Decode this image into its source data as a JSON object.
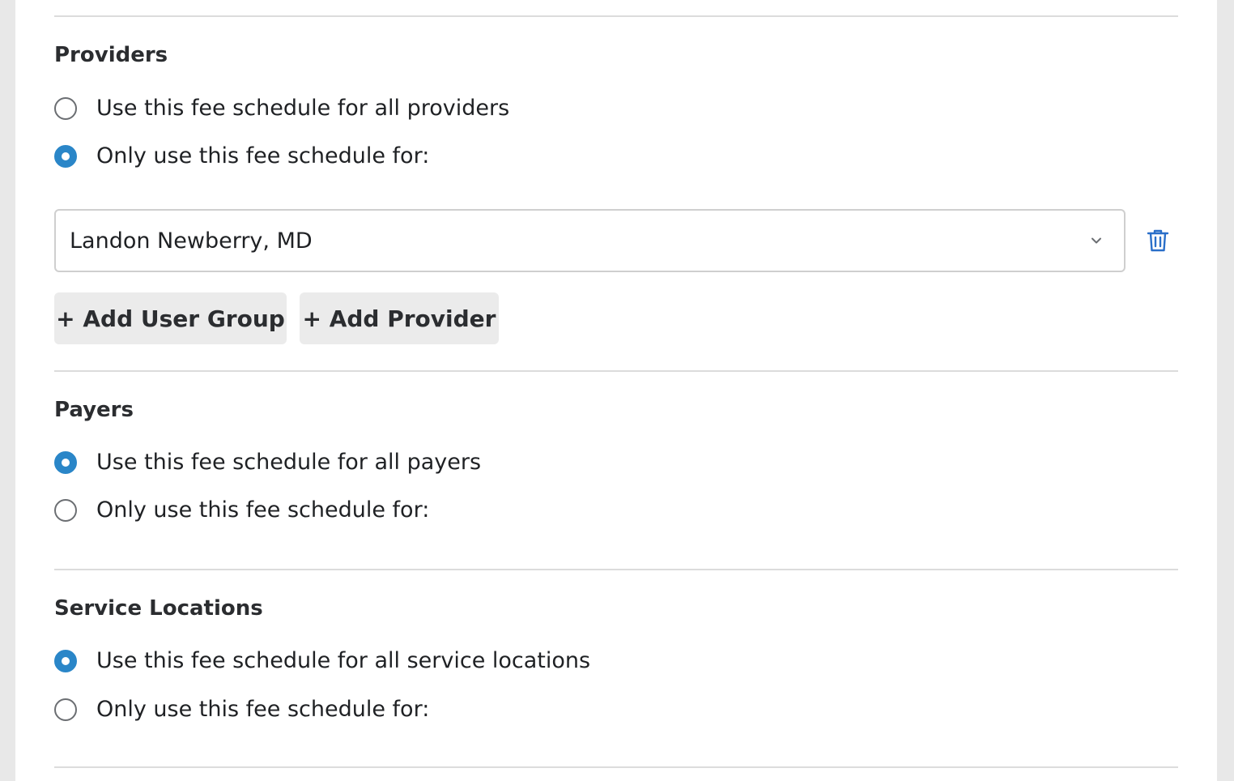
{
  "providers": {
    "title": "Providers",
    "options": [
      {
        "label": "Use this fee schedule for all providers",
        "selected": false
      },
      {
        "label": "Only use this fee schedule for:",
        "selected": true
      }
    ],
    "selected_provider": "Landon Newberry, MD",
    "add_user_group_label": "+ Add User Group",
    "add_provider_label": "+ Add Provider"
  },
  "payers": {
    "title": "Payers",
    "options": [
      {
        "label": "Use this fee schedule for all payers",
        "selected": true
      },
      {
        "label": "Only use this fee schedule for:",
        "selected": false
      }
    ]
  },
  "service_locations": {
    "title": "Service Locations",
    "options": [
      {
        "label": "Use this fee schedule for all service locations",
        "selected": true
      },
      {
        "label": "Only use this fee schedule for:",
        "selected": false
      }
    ]
  },
  "icons": {
    "dropdown": "chevron-down-icon",
    "delete": "trash-icon"
  },
  "colors": {
    "radio_selected": "#2a86c8",
    "trash_icon": "#2a6fc9",
    "button_bg": "#ebebeb",
    "divider": "#dcdcdc"
  }
}
